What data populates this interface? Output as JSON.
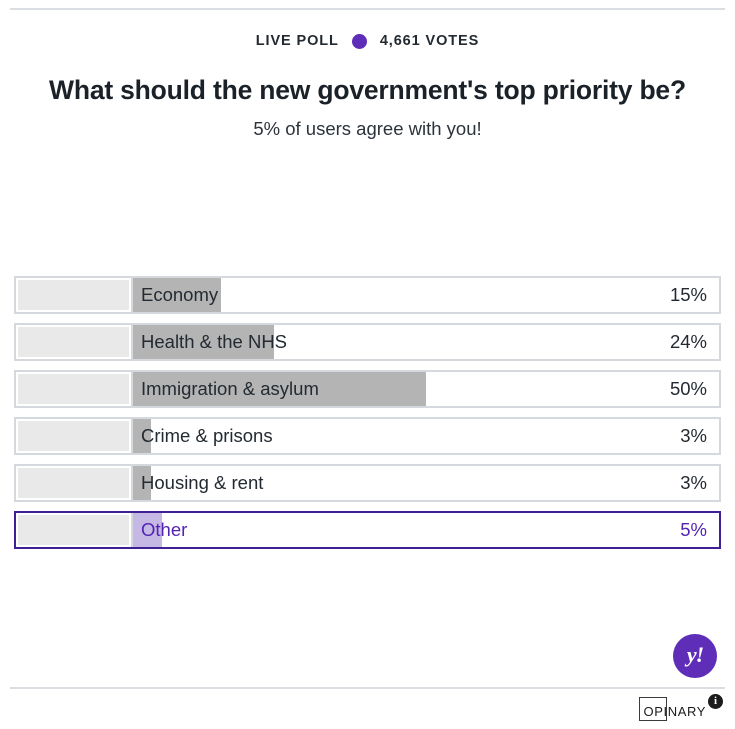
{
  "header": {
    "live_label": "LIVE POLL",
    "votes_label": "4,661 VOTES",
    "dot_icon": "live-dot-icon",
    "accent_color": "#5f2eb8"
  },
  "question": "What should the new government's top priority be?",
  "subtitle": "5% of users agree with you!",
  "poll": {
    "selected_color": "#3f1f94",
    "bar_color": "#b4b4b4",
    "selected_bar_color": "#c5b8e4",
    "options": [
      {
        "label": "Economy",
        "percent_label": "15%",
        "percent": 15,
        "selected": false
      },
      {
        "label": "Health & the NHS",
        "percent_label": "24%",
        "percent": 24,
        "selected": false
      },
      {
        "label": "Immigration & asylum",
        "percent_label": "50%",
        "percent": 50,
        "selected": false
      },
      {
        "label": "Crime & prisons",
        "percent_label": "3%",
        "percent": 3,
        "selected": false
      },
      {
        "label": "Housing & rent",
        "percent_label": "3%",
        "percent": 3,
        "selected": false
      },
      {
        "label": "Other",
        "percent_label": "5%",
        "percent": 5,
        "selected": true
      }
    ]
  },
  "brand": {
    "name": "yahoo-logo",
    "glyph": "y!"
  },
  "footer": {
    "provider": "OPINARY",
    "info_glyph": "i"
  },
  "chart_data": {
    "type": "bar",
    "title": "What should the new government's top priority be?",
    "subtitle": "5% of users agree with you!",
    "categories": [
      "Economy",
      "Health & the NHS",
      "Immigration & asylum",
      "Crime & prisons",
      "Housing & rent",
      "Other"
    ],
    "values": [
      15,
      24,
      50,
      3,
      3,
      5
    ],
    "value_labels": [
      "15%",
      "24%",
      "50%",
      "3%",
      "3%",
      "5%"
    ],
    "highlighted_category": "Other",
    "total_votes_label": "4,661 VOTES",
    "total_votes": 4661,
    "xlabel": "",
    "ylabel": "",
    "xlim": [
      0,
      100
    ],
    "grid": false,
    "legend": false,
    "orientation": "horizontal"
  }
}
